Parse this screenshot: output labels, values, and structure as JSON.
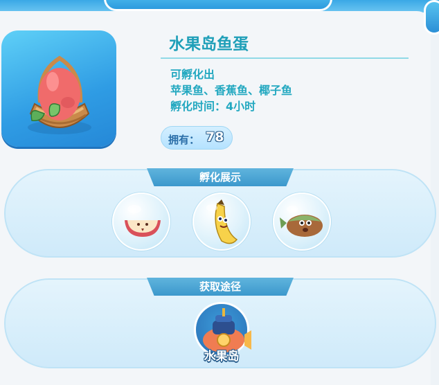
{
  "egg": {
    "name": "水果岛鱼蛋",
    "hatch_label": "可孵化出",
    "hatch_fish": "苹果鱼、香蕉鱼、椰子鱼",
    "hatch_time": "孵化时间：4小时",
    "own_label": "拥有：",
    "own_count": "78",
    "icon": "egg-in-basket"
  },
  "hatch_display": {
    "title": "孵化展示",
    "items": [
      {
        "icon": "apple-fish-icon"
      },
      {
        "icon": "banana-fish-icon"
      },
      {
        "icon": "coconut-fish-icon"
      }
    ]
  },
  "acquire": {
    "title": "获取途径",
    "sources": [
      {
        "label": "水果岛",
        "icon": "submarine-icon"
      }
    ]
  },
  "colors": {
    "accent": "#1f9fb8",
    "tab": "#3c98cc",
    "card": "#2f9ce4"
  }
}
